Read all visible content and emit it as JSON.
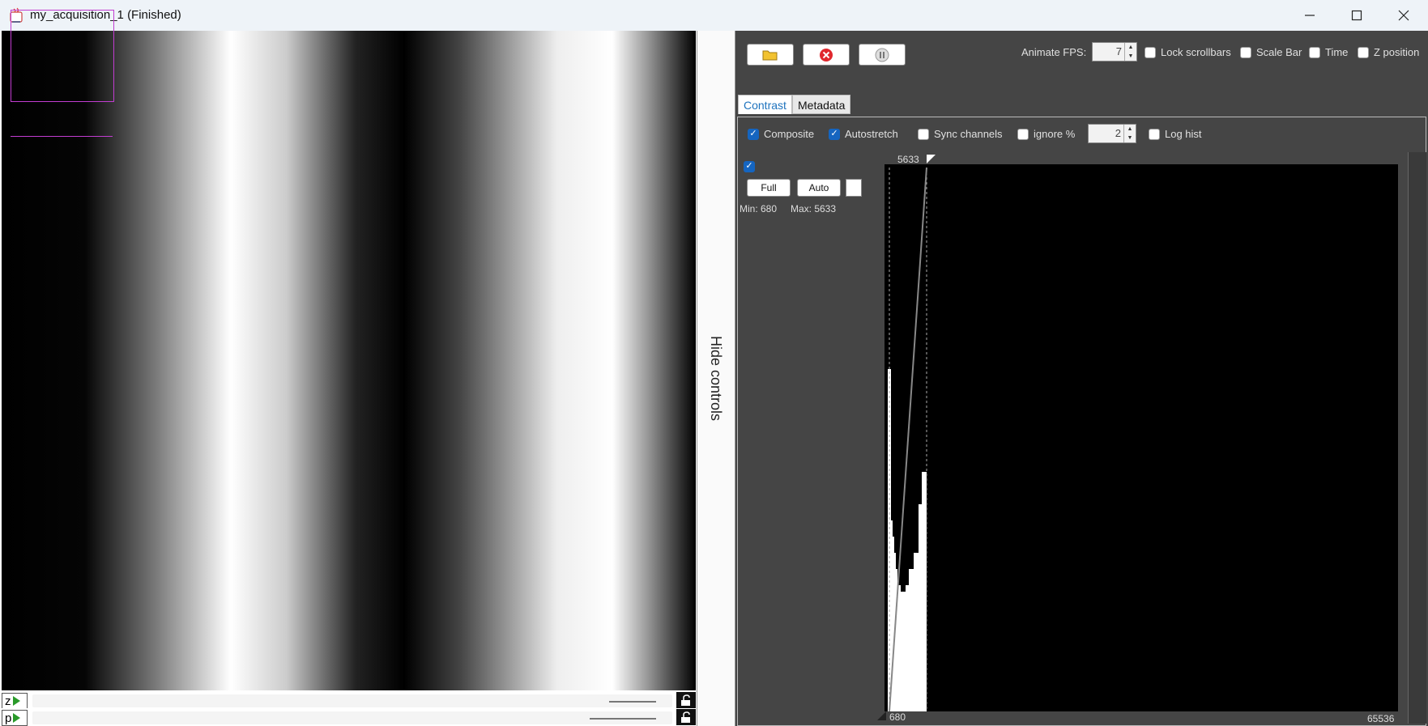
{
  "window": {
    "title": "my_acquisition_1 (Finished)",
    "controls": [
      "minimize",
      "maximize",
      "close"
    ]
  },
  "viewer": {
    "axes": [
      {
        "label": "z"
      },
      {
        "label": "p"
      }
    ]
  },
  "hide_controls": "Hide controls",
  "toolbar": {
    "animate_fps_label": "Animate FPS:",
    "animate_fps_value": "7",
    "lock_scrollbars": "Lock scrollbars",
    "scale_bar": "Scale Bar",
    "time": "Time",
    "z_position": "Z position"
  },
  "tabs": {
    "contrast": "Contrast",
    "metadata": "Metadata"
  },
  "options": {
    "composite": {
      "label": "Composite",
      "checked": true
    },
    "autostretch": {
      "label": "Autostretch",
      "checked": true
    },
    "sync_channels": {
      "label": "Sync channels",
      "checked": false
    },
    "ignore_pct": {
      "label": "ignore %",
      "checked": false,
      "value": "2"
    },
    "log_hist": {
      "label": "Log hist",
      "checked": false
    }
  },
  "channel": {
    "full_label": "Full",
    "auto_label": "Auto",
    "min_text": "Min: 680",
    "max_text": "Max: 5633"
  },
  "histogram": {
    "top_value": "5633",
    "bottom_value": "680",
    "max_range": "65536"
  },
  "colors": {
    "panel_bg": "#454545",
    "roi": "#c23dd1",
    "checkbox_on": "#1565c0",
    "tab_active_text": "#1e73be"
  }
}
